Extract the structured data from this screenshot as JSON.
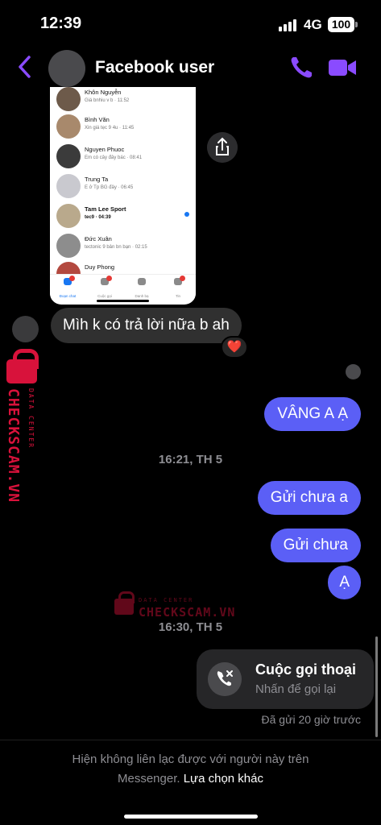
{
  "status_bar": {
    "time": "12:39",
    "network": "4G",
    "battery": "100"
  },
  "header": {
    "contact_name": "Facebook user"
  },
  "shared_image": {
    "chats": [
      {
        "name": "Khôn Nguyễn",
        "preview": "Giá bnhiu v b · 11:52",
        "bold": false,
        "unread": false,
        "avatar_color": "#6d5a4a"
      },
      {
        "name": "Bình Văn",
        "preview": "Xin giá tẹc 9 4u · 11:45",
        "bold": false,
        "unread": false,
        "avatar_color": "#a8896c"
      },
      {
        "name": "Nguyen Phuoc",
        "preview": "Em có cây đây bác · 08:41",
        "bold": false,
        "unread": false,
        "avatar_color": "#3b3b3b"
      },
      {
        "name": "Trung Ta",
        "preview": "E ở Tp BG đây · 06:45",
        "bold": false,
        "unread": false,
        "avatar_color": "#c9c9cf"
      },
      {
        "name": "Tam Lee Sport",
        "preview": "tec9 · 04:39",
        "bold": true,
        "unread": true,
        "avatar_color": "#b9a98c"
      },
      {
        "name": "Đức Xuân",
        "preview": "tectonic 9 bản bn bạn · 02:15",
        "bold": false,
        "unread": false,
        "avatar_color": "#8d8d8d"
      },
      {
        "name": "Duy Phong",
        "preview": "",
        "bold": false,
        "unread": false,
        "avatar_color": "#b3493f"
      }
    ],
    "tabs": [
      {
        "label": "Đoạn chat",
        "active": true,
        "badge": true
      },
      {
        "label": "Cuộc gọi",
        "active": false,
        "badge": true
      },
      {
        "label": "Danh bạ",
        "active": false,
        "badge": false
      },
      {
        "label": "Tin",
        "active": false,
        "badge": true
      }
    ],
    "tab_badges": [
      "8",
      "2",
      "",
      ""
    ]
  },
  "messages": {
    "incoming_1": "Mìh k có trả lời nữa b ah",
    "reaction": "❤️",
    "outgoing_1": "VÂNG A Ạ",
    "timestamp_1": "16:21, TH 5",
    "outgoing_2": "Gửi chưa a",
    "outgoing_3": "Gửi chưa",
    "outgoing_4": "Ạ",
    "timestamp_2": "16:30, TH 5"
  },
  "call": {
    "title": "Cuộc gọi thoại",
    "subtitle": "Nhấn để gọi lại",
    "sent_time": "Đã gửi 20 giờ trước"
  },
  "footer": {
    "notice": "Hiện không liên lạc được với người này trên",
    "notice_line2": "Messenger.",
    "action": "Lựa chọn khác"
  },
  "watermark": {
    "main": "CHECKSCAM.VN",
    "sub": "DATA CENTER"
  },
  "colors": {
    "accent": "#8a4bff",
    "outgoing_bubble": "#5b5ff6",
    "incoming_bubble": "#303030",
    "watermark": "#d8123b"
  }
}
